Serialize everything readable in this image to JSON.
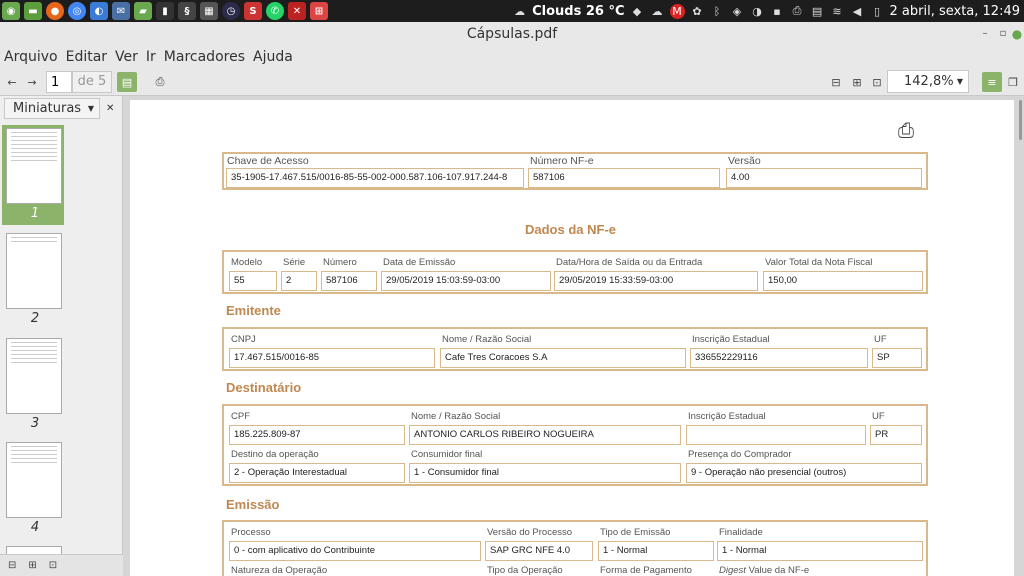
{
  "panel": {
    "weather": "Clouds 26 °C",
    "datetime": "2 abril, sexta, 12:49"
  },
  "window": {
    "title": "Cápsulas.pdf"
  },
  "menu": [
    "Arquivo",
    "Editar",
    "Ver",
    "Ir",
    "Marcadores",
    "Ajuda"
  ],
  "toolbar": {
    "page": "1",
    "of_pages": "de 5",
    "zoom": "142,8%"
  },
  "sidebar": {
    "title": "Miniaturas",
    "pages": [
      "1",
      "2",
      "3",
      "4"
    ]
  },
  "doc": {
    "header": {
      "chave_label": "Chave de Acesso",
      "chave": "35-1905-17.467.515/0016-85-55-002-000.587.106-107.917.244-8",
      "numero_label": "Número NF-e",
      "numero": "587106",
      "versao_label": "Versão",
      "versao": "4.00"
    },
    "dados_title": "Dados da NF-e",
    "dados": {
      "modelo_label": "Modelo",
      "modelo": "55",
      "serie_label": "Série",
      "serie": "2",
      "numero_label": "Número",
      "numero": "587106",
      "emissao_label": "Data de Emissão",
      "emissao": "29/05/2019 15:03:59-03:00",
      "saida_label": "Data/Hora de Saída ou da Entrada",
      "saida": "29/05/2019 15:33:59-03:00",
      "valor_label": "Valor Total da Nota Fiscal",
      "valor": "150,00"
    },
    "emitente_title": "Emitente",
    "emitente": {
      "cnpj_label": "CNPJ",
      "cnpj": "17.467.515/0016-85",
      "nome_label": "Nome / Razão Social",
      "nome": "Cafe Tres Coracoes S.A",
      "ie_label": "Inscrição Estadual",
      "ie": "336552229116",
      "uf_label": "UF",
      "uf": "SP"
    },
    "dest_title": "Destinatário",
    "dest": {
      "cpf_label": "CPF",
      "cpf": "185.225.809-87",
      "nome_label": "Nome / Razão Social",
      "nome": "ANTONIO CARLOS RIBEIRO NOGUEIRA",
      "ie_label": "Inscrição Estadual",
      "ie": "",
      "uf_label": "UF",
      "uf": "PR",
      "destino_label": "Destino da operação",
      "destino": "2 - Operação Interestadual",
      "consumidor_label": "Consumidor final",
      "consumidor": "1 - Consumidor final",
      "presenca_label": "Presença do Comprador",
      "presenca": "9 - Operação não presencial (outros)"
    },
    "emissao_title": "Emissão",
    "emissao": {
      "processo_label": "Processo",
      "processo": "0 - com aplicativo do Contribuinte",
      "versao_label": "Versão do Processo",
      "versao": "SAP GRC NFE 4.0",
      "tipo_label": "Tipo de Emissão",
      "tipo": "1 - Normal",
      "final_label": "Finalidade",
      "final": "1 - Normal",
      "natureza_label": "Natureza da Operação",
      "tipo_op_label": "Tipo da Operação",
      "pagamento_label": "Forma de Pagamento",
      "digest_em": "Digest",
      "digest_rest": " Value da NF-e"
    }
  }
}
